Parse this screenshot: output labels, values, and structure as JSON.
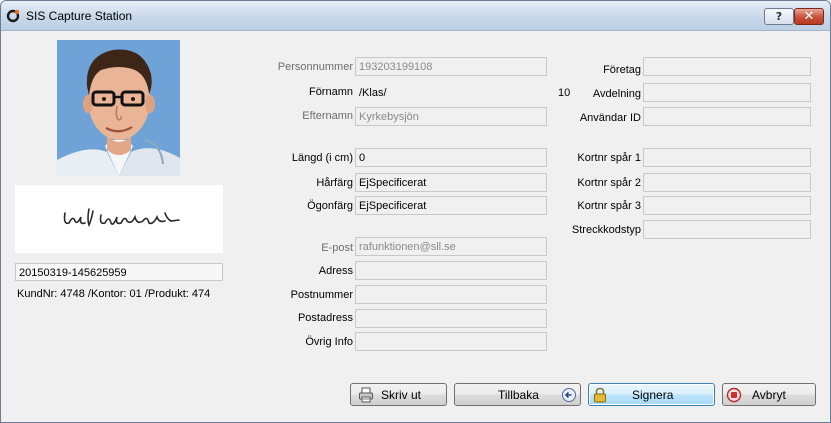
{
  "window": {
    "title": "SIS Capture Station",
    "help_label": "?",
    "close_label": "✕"
  },
  "left": {
    "capture_id": "20150319-145625959",
    "order_info": "KundNr: 4748 /Kontor: 01 /Produkt: 474"
  },
  "form_left": {
    "personnummer_label": "Personnummer",
    "personnummer_value": "193203199108",
    "fornamn_label": "Förnamn",
    "fornamn_value": "/Klas/",
    "fornamn_count": "10",
    "efternamn_label": "Efternamn",
    "efternamn_value": "Kyrkebysjön",
    "langd_label": "Längd (i cm)",
    "langd_value": "0",
    "harfarg_label": "Hårfärg",
    "harfarg_value": "EjSpecificerat",
    "ogonfarg_label": "Ögonfärg",
    "ogonfarg_value": "EjSpecificerat",
    "epost_label": "E-post",
    "epost_value": "rafunktionen@sll.se",
    "adress_label": "Adress",
    "adress_value": "",
    "postnummer_label": "Postnummer",
    "postnummer_value": "",
    "postadress_label": "Postadress",
    "postadress_value": "",
    "ovrig_label": "Övrig Info",
    "ovrig_value": ""
  },
  "form_right": {
    "foretag_label": "Företag",
    "foretag_value": "",
    "avdelning_label": "Avdelning",
    "avdelning_value": "",
    "anvandar_label": "Användar ID",
    "anvandar_value": "",
    "kortnr1_label": "Kortnr spår 1",
    "kortnr1_value": "",
    "kortnr2_label": "Kortnr spår 2",
    "kortnr2_value": "",
    "kortnr3_label": "Kortnr spår 3",
    "kortnr3_value": "",
    "streckkod_label": "Streckkodstyp",
    "streckkod_value": ""
  },
  "buttons": {
    "print": "Skriv ut",
    "back": "Tillbaka",
    "sign": "Signera",
    "cancel": "Avbryt"
  },
  "icons": {
    "app": "sis-logo-icon",
    "print": "printer-icon",
    "back": "back-arrow-icon",
    "sign": "padlock-icon",
    "cancel": "stop-icon"
  },
  "colors": {
    "photo_background": "#6fa3d8",
    "close_button": "#c75139",
    "active_button_border": "#3c7fb1"
  }
}
